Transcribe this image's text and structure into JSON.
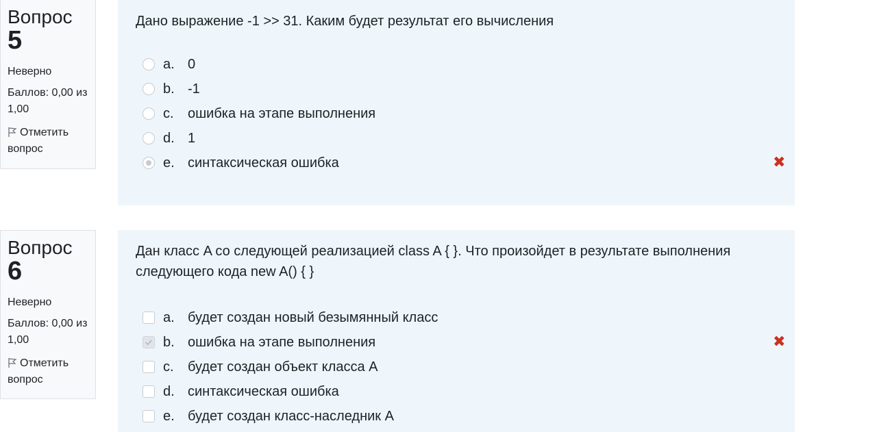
{
  "questions": [
    {
      "label": "Вопрос",
      "number": "5",
      "state": "Неверно",
      "grade": "Баллов: 0,00 из 1,00",
      "flag": "Отметить вопрос",
      "text": "Дано выражение -1 >> 31. Каким будет результат его вычисления",
      "answers": [
        {
          "letter": "a.",
          "text": "0",
          "selected": false
        },
        {
          "letter": "b.",
          "text": "-1",
          "selected": false
        },
        {
          "letter": "c.",
          "text": "ошибка на этапе выполнения",
          "selected": false
        },
        {
          "letter": "d.",
          "text": "1",
          "selected": false
        },
        {
          "letter": "e.",
          "text": "синтаксическая ошибка",
          "selected": true,
          "mark": "✖"
        }
      ]
    },
    {
      "label": "Вопрос",
      "number": "6",
      "state": "Неверно",
      "grade": "Баллов: 0,00 из 1,00",
      "flag": "Отметить вопрос",
      "text": "Дан класс A со следующей реализацией class A { }. Что произойдет в результате выполнения следующего кода new A() { }",
      "answers": [
        {
          "letter": "a.",
          "text": "будет создан новый безымянный класс",
          "selected": false
        },
        {
          "letter": "b.",
          "text": "ошибка на этапе выполнения",
          "selected": true,
          "mark": "✖"
        },
        {
          "letter": "c.",
          "text": "будет создан объект класса A",
          "selected": false
        },
        {
          "letter": "d.",
          "text": "синтаксическая ошибка",
          "selected": false
        },
        {
          "letter": "e.",
          "text": "будет создан класс-наследник A",
          "selected": false
        }
      ]
    }
  ],
  "colors": {
    "incorrect": "#ca3120",
    "panel": "#eef6fb",
    "info": "#f8f9fa"
  }
}
